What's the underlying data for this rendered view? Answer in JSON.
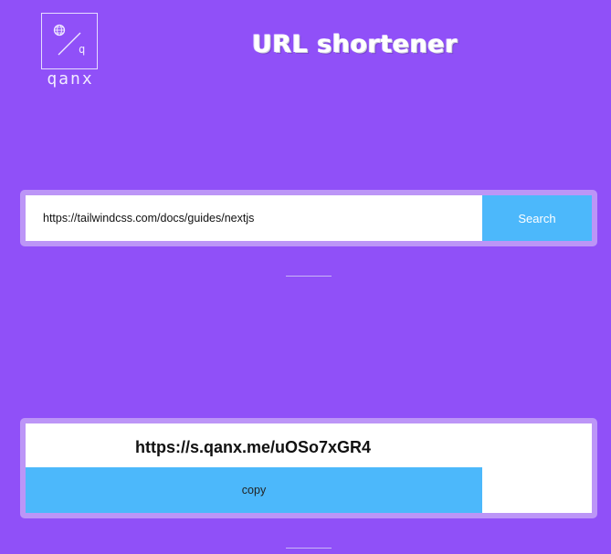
{
  "brand": {
    "logo_text": "qanx",
    "logo_icon": "globe-slash-q-icon",
    "logo_letter": "q"
  },
  "header": {
    "title": "URL shortener"
  },
  "search": {
    "input_value": "https://tailwindcss.com/docs/guides/nextjs",
    "button_label": "Search"
  },
  "result": {
    "short_url": "https://s.qanx.me/uOSo7xGR4",
    "copy_label": "copy"
  },
  "colors": {
    "background": "#9050f8",
    "panel": "#bc95f7",
    "accent": "#4cb8fb"
  }
}
